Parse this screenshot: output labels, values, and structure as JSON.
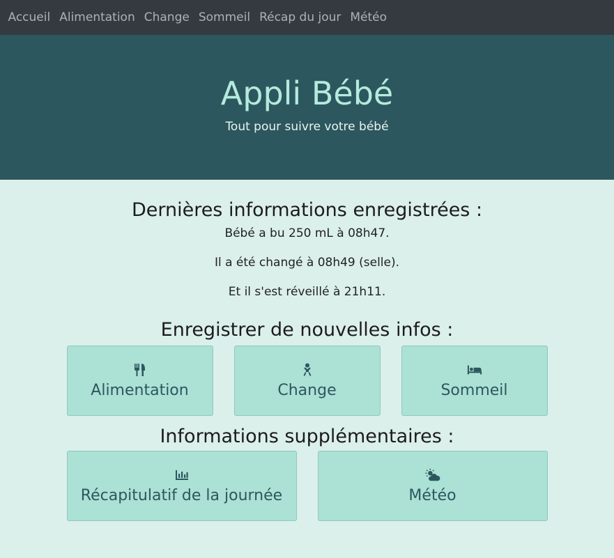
{
  "nav": {
    "items": [
      {
        "label": "Accueil"
      },
      {
        "label": "Alimentation"
      },
      {
        "label": "Change"
      },
      {
        "label": "Sommeil"
      },
      {
        "label": "Récap du jour"
      },
      {
        "label": "Météo"
      }
    ]
  },
  "hero": {
    "title": "Appli Bébé",
    "subtitle": "Tout pour suivre votre bébé"
  },
  "latest": {
    "heading": "Dernières informations enregistrées :",
    "lines": [
      "Bébé a bu 250 mL à 08h47.",
      "Il a été changé à 08h49 (selle).",
      "Et il s'est réveillé à 21h11."
    ]
  },
  "record": {
    "heading": "Enregistrer de nouvelles infos :",
    "buttons": [
      {
        "label": "Alimentation",
        "icon": "utensils-icon"
      },
      {
        "label": "Change",
        "icon": "baby-icon"
      },
      {
        "label": "Sommeil",
        "icon": "bed-icon"
      }
    ]
  },
  "extra": {
    "heading": "Informations supplémentaires :",
    "buttons": [
      {
        "label": "Récapitulatif de la journée",
        "icon": "chart-bar-icon"
      },
      {
        "label": "Météo",
        "icon": "cloud-sun-icon"
      }
    ]
  },
  "colors": {
    "navbar": "#343a40",
    "hero_bg": "#2d575e",
    "hero_title": "#b4ebdd",
    "page_bg": "#dcf0eb",
    "tile_bg": "#ace1d5",
    "tile_text": "#2d575e"
  }
}
